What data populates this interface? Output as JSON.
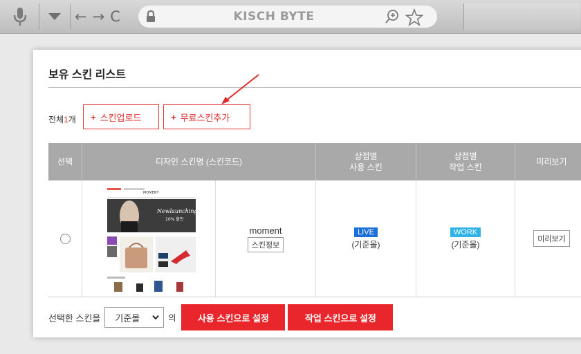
{
  "browser": {
    "url_text": "KISCH BYTE",
    "icons": [
      "microphone-icon",
      "dropdown-icon",
      "back-icon",
      "forward-icon",
      "reload-icon",
      "lock-icon",
      "zoom-icon",
      "star-icon"
    ],
    "back_glyph": "←",
    "forward_glyph": "→",
    "reload_glyph": "C"
  },
  "panel": {
    "title": "보유 스킨 리스트",
    "total_prefix": "전체",
    "total_count": "1",
    "total_suffix": "개",
    "upload_label": "스킨업로드",
    "free_add_label": "무료스킨추가",
    "plus_glyph": "+"
  },
  "table": {
    "headers": {
      "select": "선택",
      "design": "디자인 스킨명 (스킨코드)",
      "use_line1": "상점별",
      "use_line2": "사용 스킨",
      "work_line1": "상점별",
      "work_line2": "작업 스킨",
      "preview": "미리보기"
    },
    "rows": [
      {
        "skin_name": "moment",
        "info_label": "스킨정보",
        "live_badge": "LIVE",
        "live_status": "(기준몰)",
        "work_badge": "WORK",
        "work_status": "(기준몰)",
        "preview_label": "미리보기",
        "thumb_brand": "MOMENT",
        "thumb_banner_line1": "Newlaunching",
        "thumb_banner_line2": "10% 할인"
      }
    ]
  },
  "bottom": {
    "select_label": "선택한 스킨을",
    "select_value": "기준몰",
    "select_suffix": "의",
    "set_live_label": "사용 스킨으로 설정",
    "set_work_label": "작업 스킨으로 설정"
  },
  "colors": {
    "accent_red": "#e8262b",
    "live_blue": "#1c6fd8",
    "work_blue": "#2fb3e6",
    "header_gray": "#a9a9a9"
  }
}
